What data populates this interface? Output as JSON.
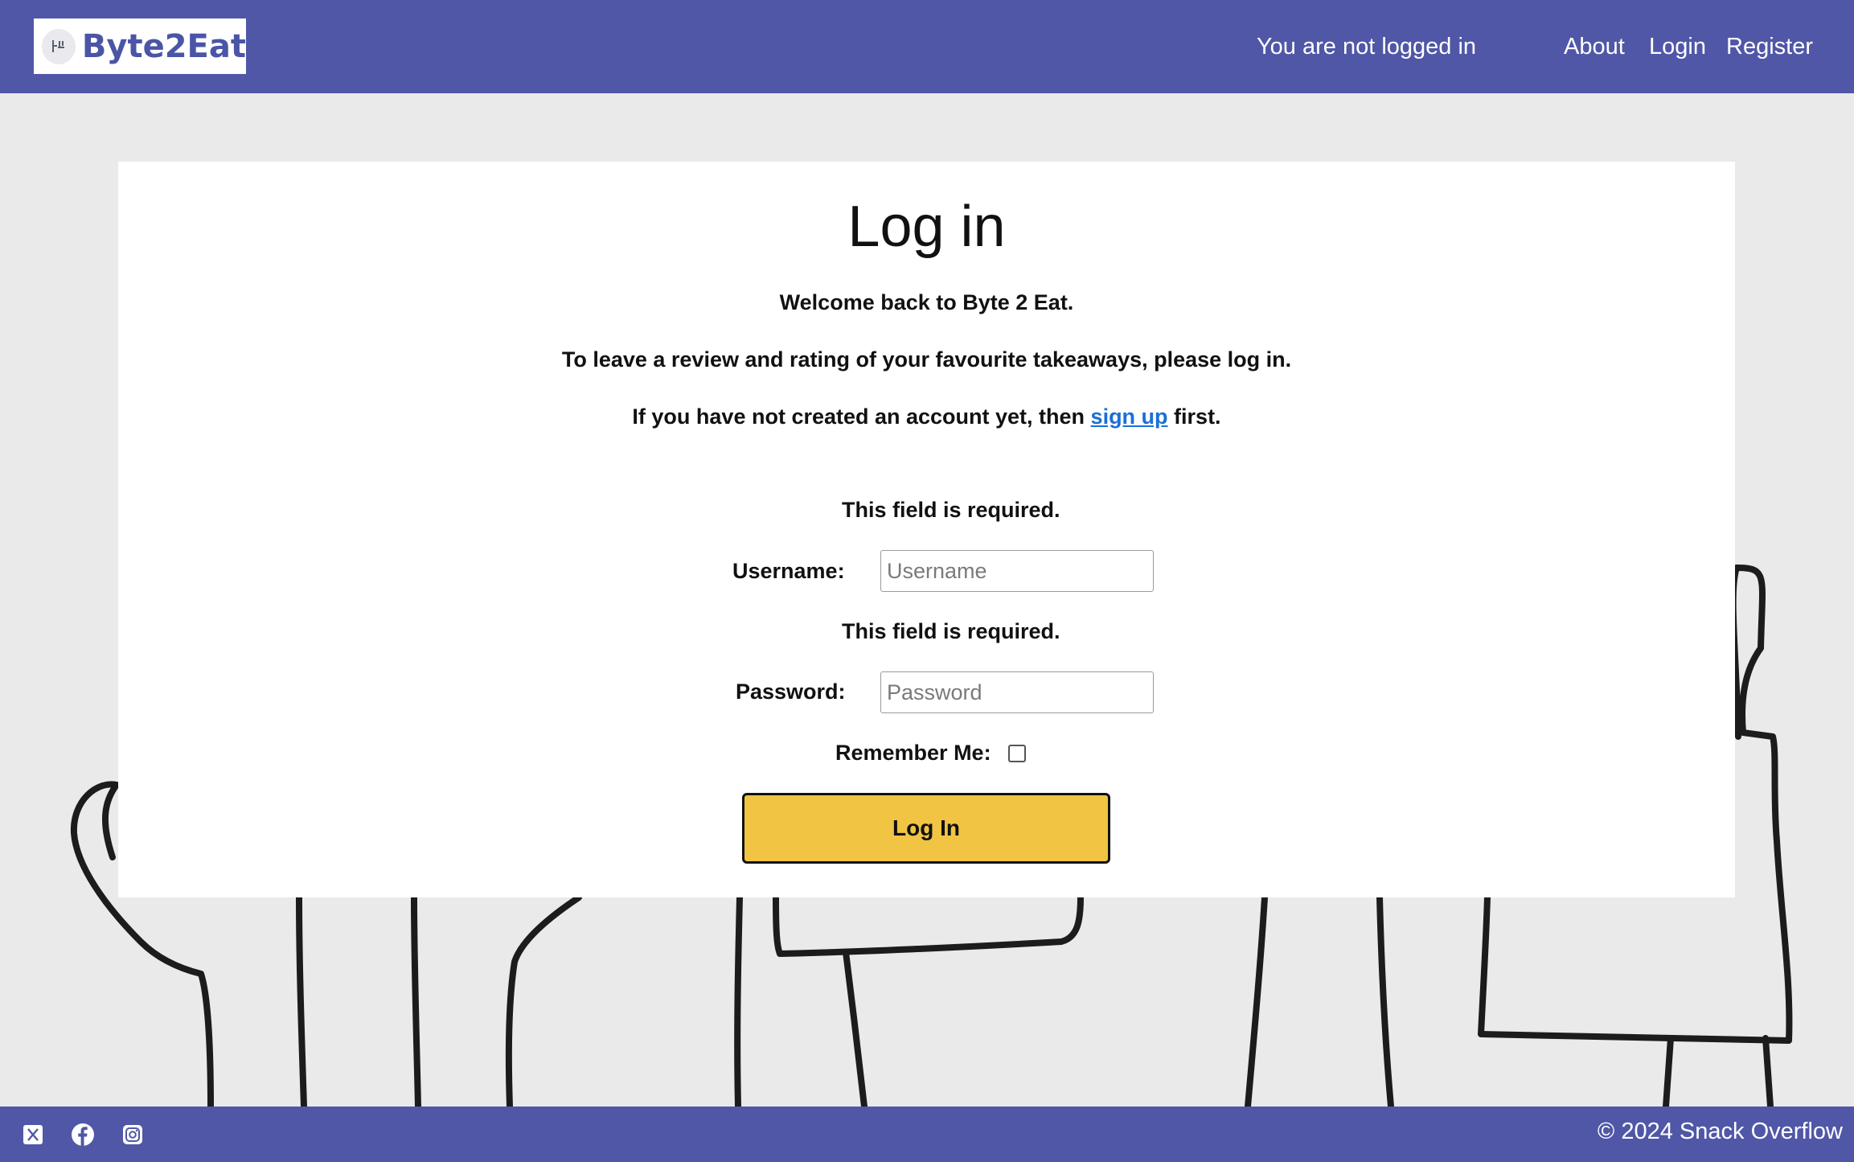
{
  "header": {
    "brand": "Byte2Eat",
    "status": "You are not logged in",
    "nav": {
      "about": "About",
      "login": "Login",
      "register": "Register"
    }
  },
  "login": {
    "title": "Log in",
    "welcome": "Welcome back to Byte 2 Eat.",
    "intro": "To leave a review and rating of your favourite takeaways, please log in.",
    "signup_prefix": "If you have not created an account yet, then ",
    "signup_link": "sign up",
    "signup_suffix": " first.",
    "username_error": "This field is required.",
    "username_label": "Username:",
    "username_placeholder": "Username",
    "username_value": "",
    "password_error": "This field is required.",
    "password_label": "Password:",
    "password_placeholder": "Password",
    "password_value": "",
    "remember_label": "Remember Me:",
    "remember_checked": false,
    "submit_label": "Log In"
  },
  "footer": {
    "copyright": "© 2024 Snack Overflow",
    "social_icons": [
      "x-icon",
      "facebook-icon",
      "instagram-icon"
    ]
  },
  "colors": {
    "brand": "#5057a7",
    "button": "#f2c443",
    "background": "#eaeaea",
    "link": "#1a6fd8"
  }
}
